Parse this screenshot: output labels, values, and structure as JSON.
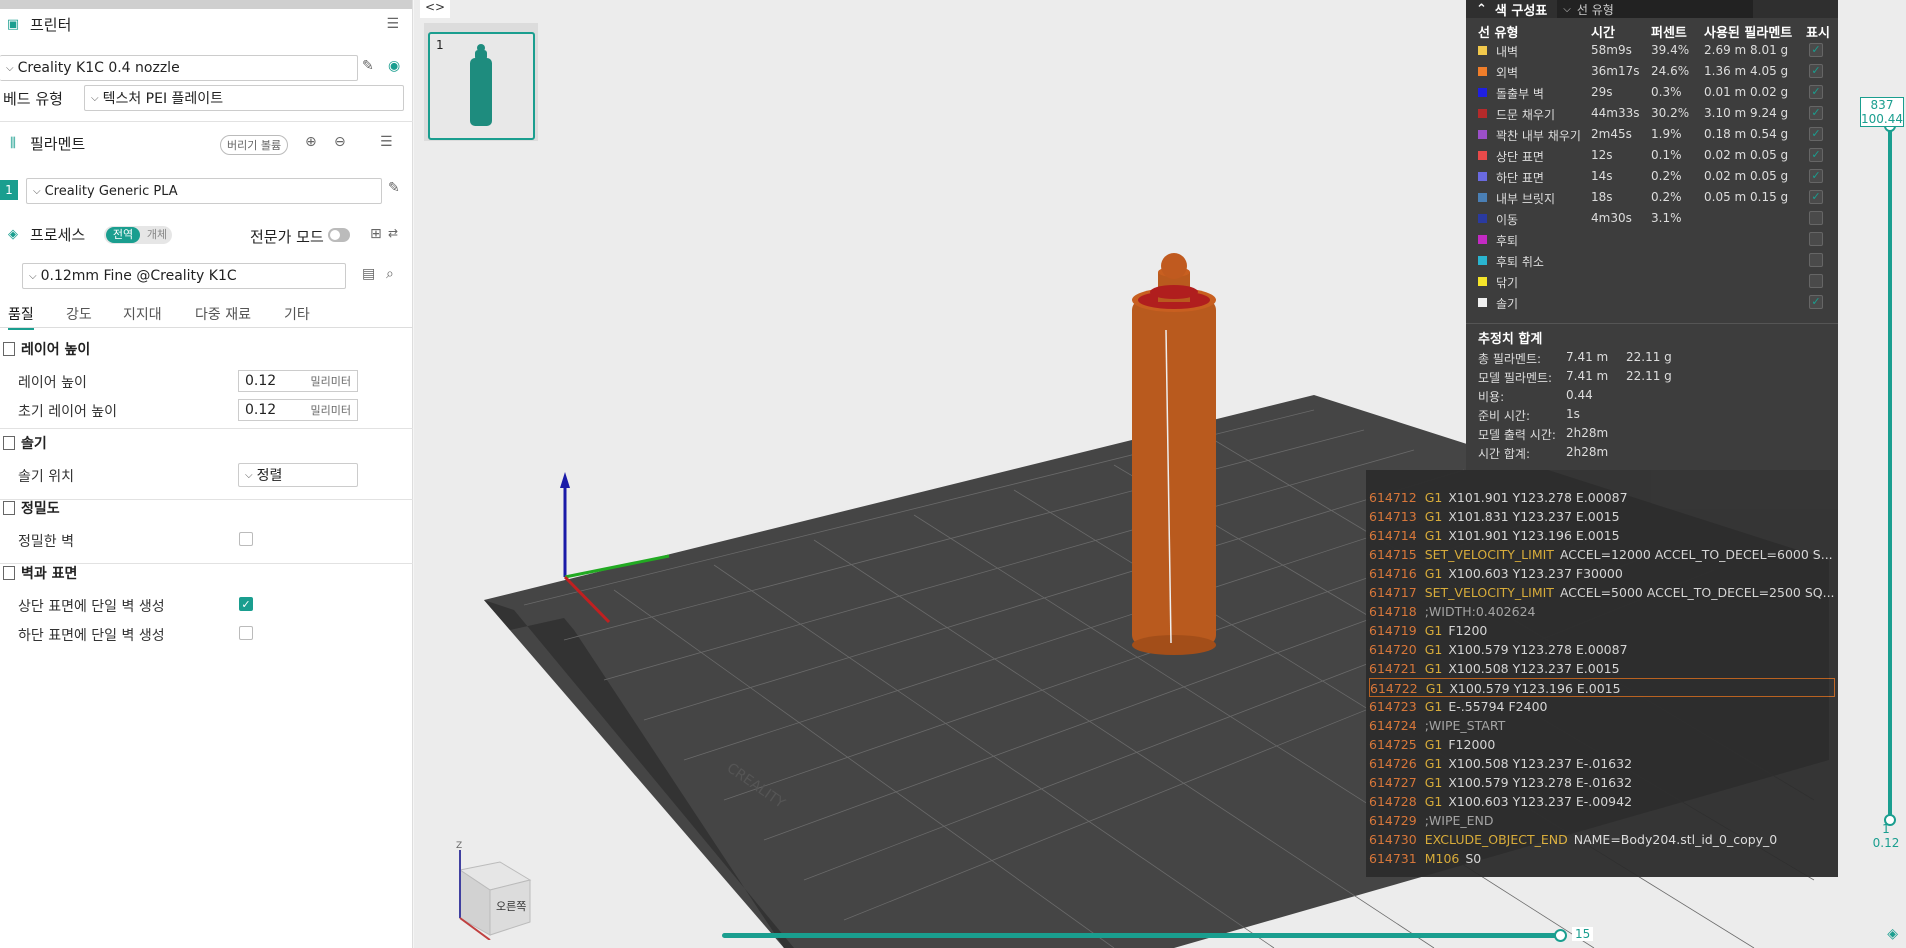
{
  "printer": {
    "title": "프린터",
    "name": "Creality K1C 0.4 nozzle",
    "bed_label": "베드 유형",
    "bed": "텍스처 PEI 플레이트"
  },
  "filament": {
    "title": "필라멘트",
    "flush_btn": "버리기 볼륨",
    "slot": "1",
    "name": "Creality Generic PLA"
  },
  "process": {
    "title": "프로세스",
    "global": "전역",
    "object": "개체",
    "expert": "전문가 모드",
    "profile": "0.12mm Fine @Creality K1C"
  },
  "tabs": [
    "품질",
    "강도",
    "지지대",
    "다중 재료",
    "기타"
  ],
  "quality": {
    "layer_height_sec": "레이어 높이",
    "layer_height": "레이어 높이",
    "layer_height_val": "0.12",
    "unit": "밀리미터",
    "init_layer": "초기 레이어 높이",
    "init_layer_val": "0.12",
    "seam_sec": "솔기",
    "seam_pos": "솔기 위치",
    "seam_val": "정렬",
    "precision_sec": "정밀도",
    "precise_wall": "정밀한 벽",
    "wall_sec": "벽과 표면",
    "top_single": "상단 표면에 단일 벽 생성",
    "bottom_single": "하단 표면에 단일 벽 생성"
  },
  "viewport": {
    "plate_num": "1",
    "toggle": "<>",
    "nav_cube": "오른쪽",
    "axis_z": "Z",
    "plate_brand": "CREALITY",
    "h_slider_val": "15",
    "v_top1": "837",
    "v_top2": "100.44",
    "v_bot1": "1",
    "v_bot2": "0.12"
  },
  "legend": {
    "title": "색 구성표",
    "view": "선 유형",
    "cols": [
      "선 유형",
      "시간",
      "퍼센트",
      "사용된 필라멘트",
      "표시"
    ],
    "rows": [
      {
        "name": "내벽",
        "time": "58m9s",
        "pct": "39.4%",
        "len": "2.69 m",
        "wt": "8.01 g",
        "color": "#f2c94c",
        "shown": true
      },
      {
        "name": "외벽",
        "time": "36m17s",
        "pct": "24.6%",
        "len": "1.36 m",
        "wt": "4.05 g",
        "color": "#f07e2a",
        "shown": true
      },
      {
        "name": "돌출부 벽",
        "time": "29s",
        "pct": "0.3%",
        "len": "0.01 m",
        "wt": "0.02 g",
        "color": "#1f1fe0",
        "shown": true
      },
      {
        "name": "드문 채우기",
        "time": "44m33s",
        "pct": "30.2%",
        "len": "3.10 m",
        "wt": "9.24 g",
        "color": "#b52a2a",
        "shown": true
      },
      {
        "name": "꽉찬 내부 채우기",
        "time": "2m45s",
        "pct": "1.9%",
        "len": "0.18 m",
        "wt": "0.54 g",
        "color": "#9b4fc9",
        "shown": true
      },
      {
        "name": "상단 표면",
        "time": "12s",
        "pct": "0.1%",
        "len": "0.02 m",
        "wt": "0.05 g",
        "color": "#e84a4a",
        "shown": true
      },
      {
        "name": "하단 표면",
        "time": "14s",
        "pct": "0.2%",
        "len": "0.02 m",
        "wt": "0.05 g",
        "color": "#6a6ae0",
        "shown": true
      },
      {
        "name": "내부 브릿지",
        "time": "18s",
        "pct": "0.2%",
        "len": "0.05 m",
        "wt": "0.15 g",
        "color": "#4a7fb5",
        "shown": true
      },
      {
        "name": "이동",
        "time": "4m30s",
        "pct": "3.1%",
        "len": "",
        "wt": "",
        "color": "#2a3aa0",
        "shown": false
      },
      {
        "name": "후퇴",
        "time": "",
        "pct": "",
        "len": "",
        "wt": "",
        "color": "#c42ac4",
        "shown": false
      },
      {
        "name": "후퇴 취소",
        "time": "",
        "pct": "",
        "len": "",
        "wt": "",
        "color": "#2ab5d0",
        "shown": false
      },
      {
        "name": "닦기",
        "time": "",
        "pct": "",
        "len": "",
        "wt": "",
        "color": "#f5e52a",
        "shown": false
      },
      {
        "name": "솔기",
        "time": "",
        "pct": "",
        "len": "",
        "wt": "",
        "color": "#f0f0f0",
        "shown": true
      }
    ],
    "sum_title": "추정치 합계",
    "sum": [
      {
        "k": "총 필라멘트:",
        "v": "7.41 m",
        "w": "22.11 g"
      },
      {
        "k": "모델 필라멘트:",
        "v": "7.41 m",
        "w": "22.11 g"
      },
      {
        "k": "비용:",
        "v": "0.44",
        "w": ""
      },
      {
        "k": "준비 시간:",
        "v": "1s",
        "w": ""
      },
      {
        "k": "모델 출력 시간:",
        "v": "2h28m",
        "w": ""
      },
      {
        "k": "시간 합계:",
        "v": "2h28m",
        "w": ""
      }
    ]
  },
  "gcode": [
    {
      "n": "614712",
      "c": "G1",
      "a": "X101.901 Y123.278 E.00087"
    },
    {
      "n": "614713",
      "c": "G1",
      "a": "X101.831 Y123.237 E.0015"
    },
    {
      "n": "614714",
      "c": "G1",
      "a": "X101.901 Y123.196 E.0015"
    },
    {
      "n": "614715",
      "c": "SET_VELOCITY_LIMIT",
      "a": "ACCEL=12000 ACCEL_TO_DECEL=6000 S..."
    },
    {
      "n": "614716",
      "c": "G1",
      "a": "X100.603 Y123.237 F30000"
    },
    {
      "n": "614717",
      "c": "SET_VELOCITY_LIMIT",
      "a": "ACCEL=5000 ACCEL_TO_DECEL=2500 SQ..."
    },
    {
      "n": "614718",
      "c": "",
      "a": ";WIDTH:0.402624"
    },
    {
      "n": "614719",
      "c": "G1",
      "a": "F1200"
    },
    {
      "n": "614720",
      "c": "G1",
      "a": "X100.579 Y123.278 E.00087"
    },
    {
      "n": "614721",
      "c": "G1",
      "a": "X100.508 Y123.237 E.0015"
    },
    {
      "n": "614722",
      "c": "G1",
      "a": "X100.579 Y123.196 E.0015"
    },
    {
      "n": "614723",
      "c": "G1",
      "a": "E-.55794 F2400"
    },
    {
      "n": "614724",
      "c": "",
      "a": ";WIPE_START"
    },
    {
      "n": "614725",
      "c": "G1",
      "a": "F12000"
    },
    {
      "n": "614726",
      "c": "G1",
      "a": "X100.508 Y123.237 E-.01632"
    },
    {
      "n": "614727",
      "c": "G1",
      "a": "X100.579 Y123.278 E-.01632"
    },
    {
      "n": "614728",
      "c": "G1",
      "a": "X100.603 Y123.237 E-.00942"
    },
    {
      "n": "614729",
      "c": "",
      "a": ";WIPE_END"
    },
    {
      "n": "614730",
      "c": "EXCLUDE_OBJECT_END",
      "a": "NAME=Body204.stl_id_0_copy_0"
    },
    {
      "n": "614731",
      "c": "M106",
      "a": "S0"
    }
  ],
  "gcode_highlight": 10
}
